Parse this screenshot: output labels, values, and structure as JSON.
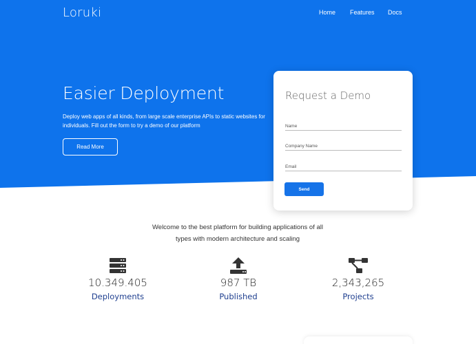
{
  "colors": {
    "primary": "#0e73ec",
    "text_dark": "#222222",
    "label_blue": "#1f3f8f"
  },
  "nav": {
    "brand": "Loruki",
    "links": [
      "Home",
      "Features",
      "Docs"
    ]
  },
  "hero": {
    "title": "Easier Deployment",
    "description": "Deploy web apps of all kinds, from large scale enterprise APIs to static websites for individuals. Fill out the form to try a demo of our platform",
    "button_label": "Read More"
  },
  "demo_form": {
    "title": "Request a Demo",
    "name_placeholder": "Name",
    "company_placeholder": "Company Name",
    "email_placeholder": "Email",
    "send_label": "Send"
  },
  "stats": {
    "intro": "Welcome to the best platform for building applications of all types with modern architecture and scaling",
    "items": [
      {
        "icon": "server-icon",
        "value": "10.349.405",
        "label": "Deployments"
      },
      {
        "icon": "upload-icon",
        "value": "987 TB",
        "label": "Published"
      },
      {
        "icon": "project-diagram-icon",
        "value": "2,343,265",
        "label": "Projects"
      }
    ]
  }
}
